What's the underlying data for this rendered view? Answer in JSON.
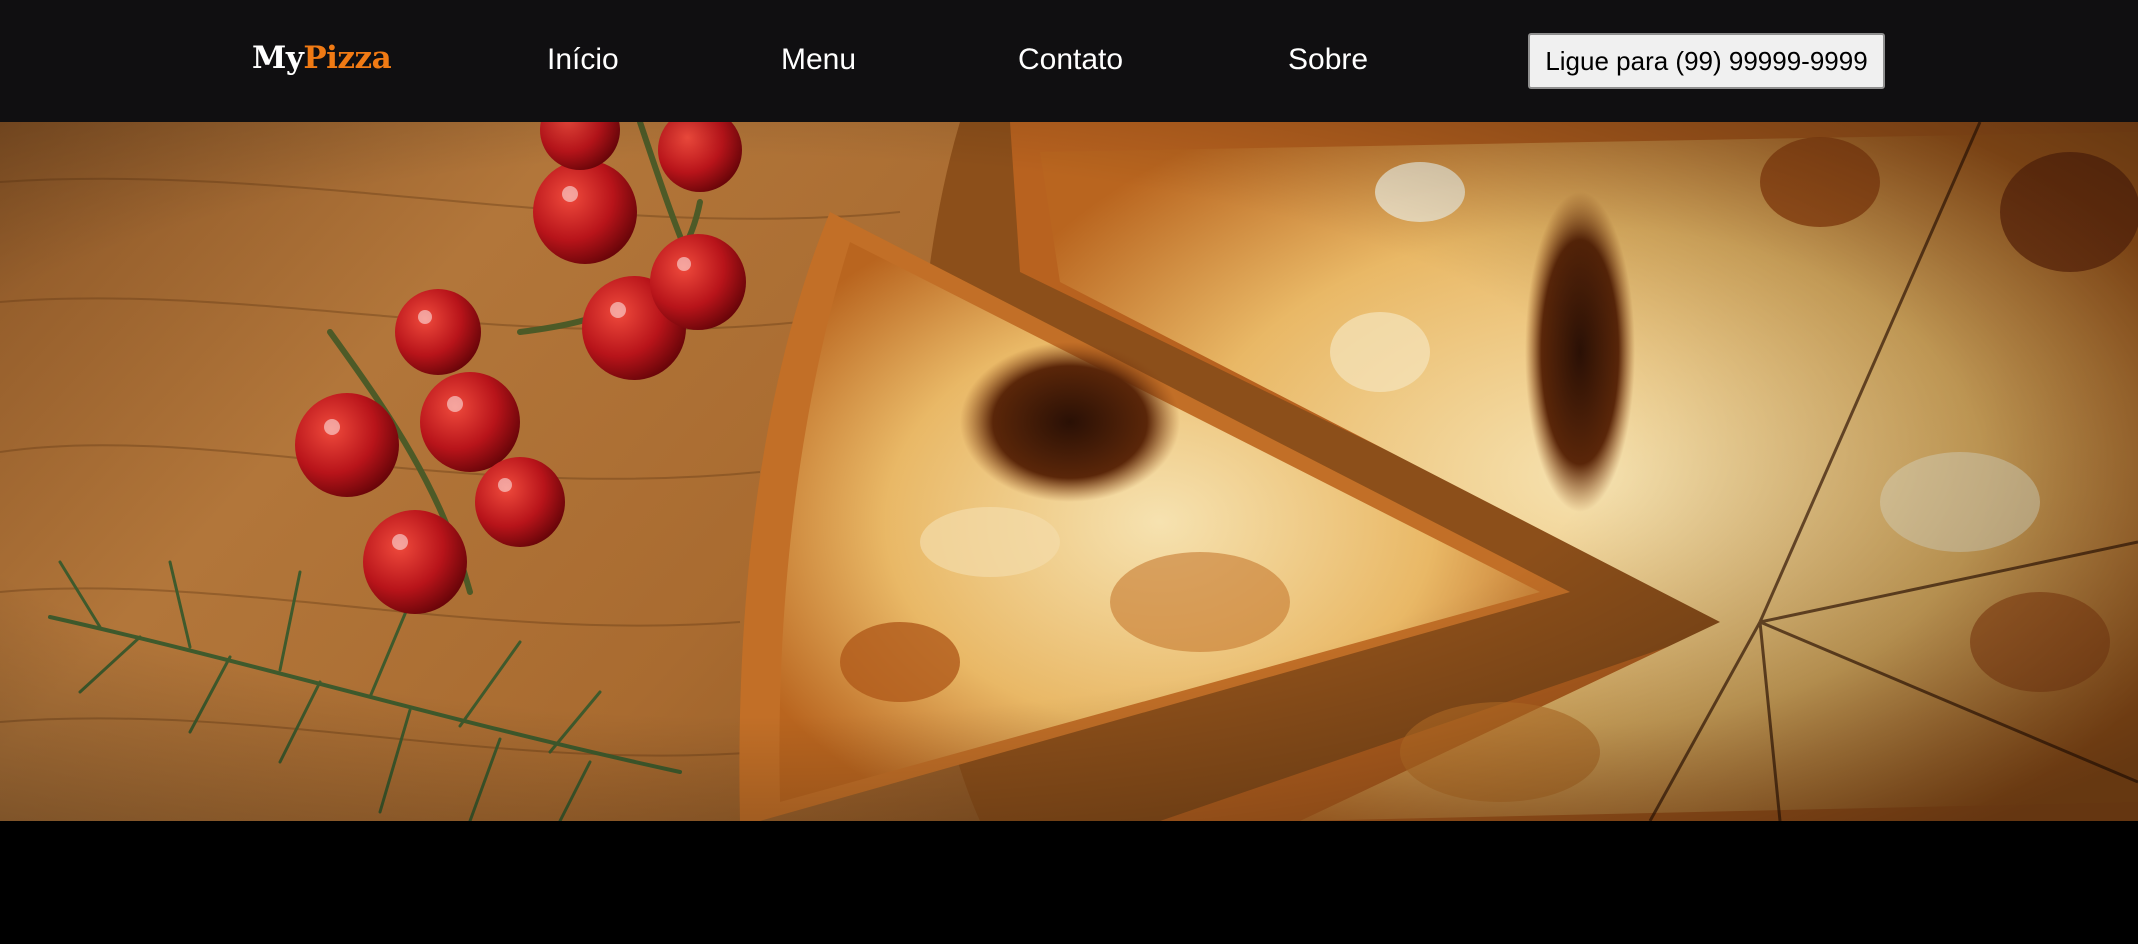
{
  "brand": {
    "logo_part1": "My",
    "logo_part2": "Pizza",
    "color_primary": "#ffffff",
    "color_accent": "#f07a14"
  },
  "nav": {
    "items": [
      {
        "label": "Início"
      },
      {
        "label": "Menu"
      },
      {
        "label": "Contato"
      },
      {
        "label": "Sobre"
      }
    ],
    "background": "#100f11"
  },
  "cta": {
    "label": "Ligue para (99) 99999-9999"
  },
  "hero": {
    "image_subject": "pizza-with-cherry-tomatoes-and-rosemary"
  }
}
